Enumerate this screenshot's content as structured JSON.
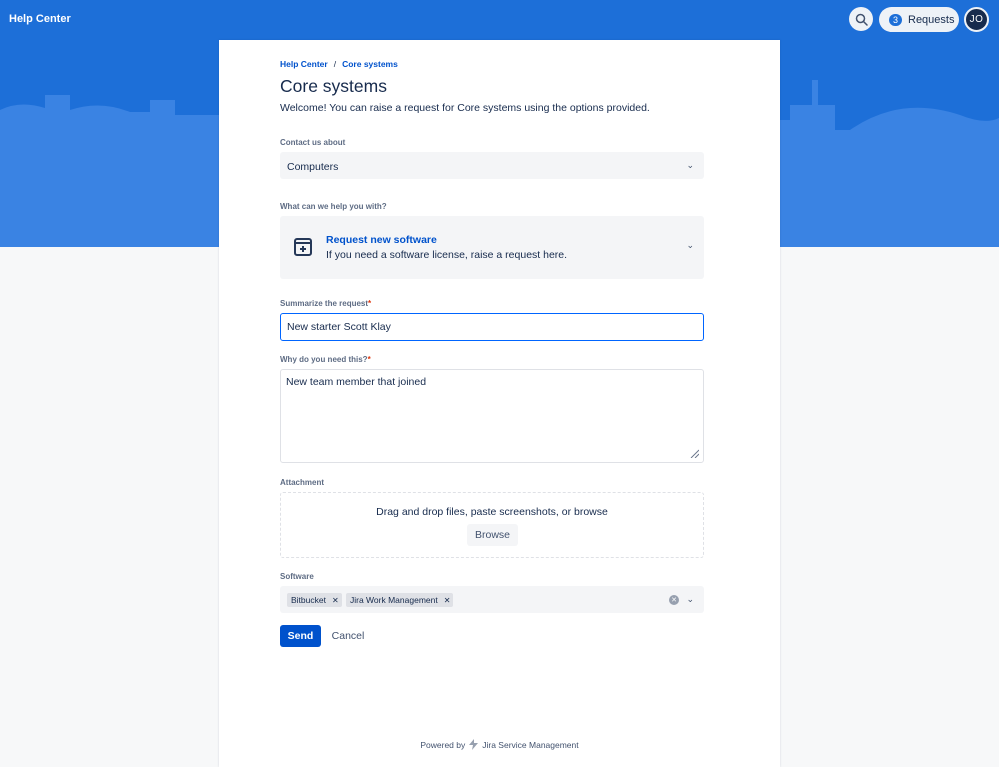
{
  "colors": {
    "hero_blue": "#1d6fd8",
    "hero_shape": "#3a83e3",
    "link_blue": "#0052cc",
    "required": "#de350b",
    "send_button": "#0052cc"
  },
  "header": {
    "brand": "Help Center",
    "search_icon": "search-icon",
    "requests_count": "3",
    "requests_label": "Requests",
    "avatar_initials": "JO"
  },
  "breadcrumb": {
    "items": [
      "Help Center",
      "Core systems"
    ],
    "separator": "/"
  },
  "page": {
    "title": "Core systems",
    "welcome": "Welcome! You can raise a request for Core systems using the options provided."
  },
  "form": {
    "contact": {
      "label": "Contact us about",
      "value": "Computers"
    },
    "request_type": {
      "label": "What can we help you with?",
      "title": "Request new software",
      "description": "If you need a software license, raise a request here.",
      "icon": "request-type-icon"
    },
    "summary": {
      "label": "Summarize the request",
      "required": "*",
      "value": "New starter Scott Klay"
    },
    "reason": {
      "label": "Why do you need this?",
      "required": "*",
      "value": "New team member that joined"
    },
    "attachment": {
      "label": "Attachment",
      "drop_text": "Drag and drop files, paste screenshots, or browse",
      "browse_label": "Browse"
    },
    "software": {
      "label": "Software",
      "selected": [
        "Bitbucket",
        "Jira Work Management"
      ]
    },
    "send_label": "Send",
    "cancel_label": "Cancel"
  },
  "footer": {
    "powered_by": "Powered by",
    "product": "Jira Service Management"
  }
}
